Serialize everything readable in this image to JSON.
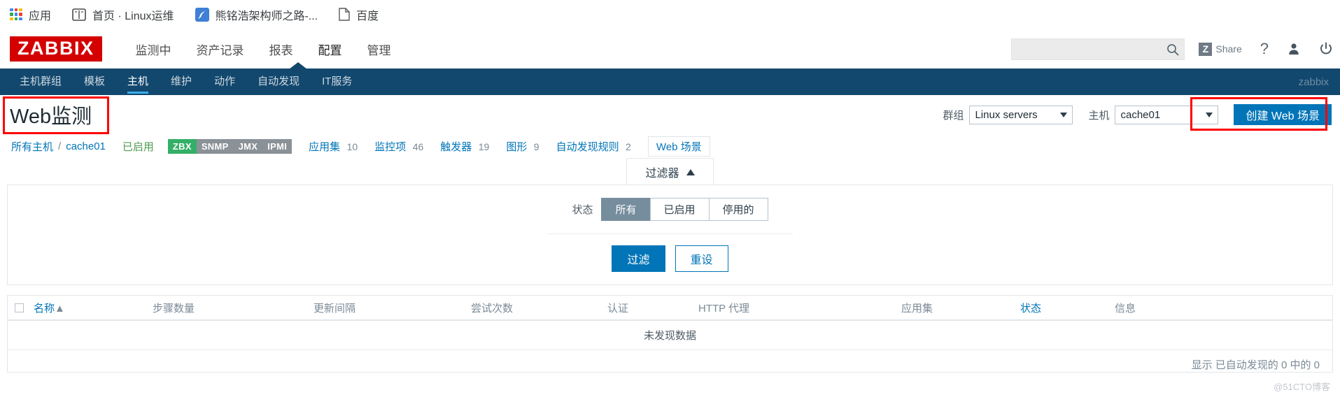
{
  "browser": {
    "bookmarks": [
      {
        "label": "应用",
        "icon": "apps-grid-icon"
      },
      {
        "label": "首页 · Linux运维",
        "icon": "book-icon"
      },
      {
        "label": "熊铭浩架构师之路-...",
        "icon": "feather-icon"
      },
      {
        "label": "百度",
        "icon": "document-icon"
      }
    ]
  },
  "header": {
    "logo": "ZABBIX",
    "nav": [
      {
        "label": "监测中",
        "active": false
      },
      {
        "label": "资产记录",
        "active": false
      },
      {
        "label": "报表",
        "active": false
      },
      {
        "label": "配置",
        "active": true
      },
      {
        "label": "管理",
        "active": false
      }
    ],
    "search": {
      "value": "",
      "placeholder": ""
    },
    "share_label": "Share",
    "share_badge": "Z",
    "help_icon": "question-mark-icon",
    "user_icon": "user-icon",
    "power_icon": "power-icon"
  },
  "subnav": {
    "items": [
      {
        "label": "主机群组",
        "active": false
      },
      {
        "label": "模板",
        "active": false
      },
      {
        "label": "主机",
        "active": true
      },
      {
        "label": "维护",
        "active": false
      },
      {
        "label": "动作",
        "active": false
      },
      {
        "label": "自动发现",
        "active": false
      },
      {
        "label": "IT服务",
        "active": false
      }
    ],
    "user": "zabbix"
  },
  "page": {
    "title": "Web监测",
    "group_label": "群组",
    "group_value": "Linux servers",
    "host_label": "主机",
    "host_value": "cache01",
    "create_button": "创建 Web 场景"
  },
  "breadcrumb": {
    "all_hosts": "所有主机",
    "separator": "/",
    "host": "cache01",
    "status": "已启用",
    "protocols": [
      {
        "label": "ZBX",
        "enabled": true
      },
      {
        "label": "SNMP",
        "enabled": false
      },
      {
        "label": "JMX",
        "enabled": false
      },
      {
        "label": "IPMI",
        "enabled": false
      }
    ],
    "links": [
      {
        "label": "应用集",
        "count": "10"
      },
      {
        "label": "监控项",
        "count": "46"
      },
      {
        "label": "触发器",
        "count": "19"
      },
      {
        "label": "图形",
        "count": "9"
      },
      {
        "label": "自动发现规则",
        "count": "2"
      }
    ],
    "current": "Web 场景"
  },
  "filter": {
    "tab_label": "过滤器",
    "tab_caret": "triangle-up-icon",
    "state_label": "状态",
    "state_options": [
      {
        "label": "所有",
        "selected": true
      },
      {
        "label": "已启用",
        "selected": false
      },
      {
        "label": "停用的",
        "selected": false
      }
    ],
    "apply_button": "过滤",
    "reset_button": "重设"
  },
  "table": {
    "columns": [
      "名称",
      "步骤数量",
      "更新间隔",
      "尝试次数",
      "认证",
      "HTTP 代理",
      "应用集",
      "状态",
      "信息"
    ],
    "sort_indicator": "▲",
    "empty_message": "未发现数据",
    "footnote": "显示 已自动发现的 0 中的 0"
  },
  "watermark": "@51CTO博客",
  "colors": {
    "brand_red": "#d40000",
    "nav_dark": "#12486e",
    "accent_blue": "#0275b8",
    "annotation_red": "#ff0000",
    "green_badge": "#34af67",
    "gray_badge": "#8a9197"
  }
}
